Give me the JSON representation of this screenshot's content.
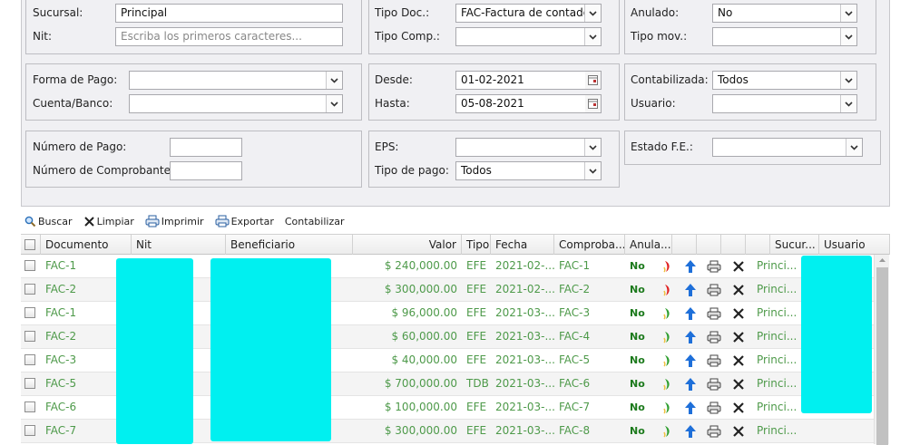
{
  "filters": {
    "sucursal": {
      "label": "Sucursal:",
      "value": "Principal"
    },
    "nit": {
      "label": "Nit:",
      "placeholder": "Escriba los primeros caracteres..."
    },
    "tipo_doc": {
      "label": "Tipo Doc.:",
      "value": "FAC-Factura de contado"
    },
    "tipo_comp": {
      "label": "Tipo Comp.:",
      "value": ""
    },
    "anulado": {
      "label": "Anulado:",
      "value": "No"
    },
    "tipo_mov": {
      "label": "Tipo mov.:",
      "value": ""
    },
    "forma_pago": {
      "label": "Forma de Pago:",
      "value": ""
    },
    "cuenta_banco": {
      "label": "Cuenta/Banco:",
      "value": ""
    },
    "desde": {
      "label": "Desde:",
      "value": "01-02-2021"
    },
    "hasta": {
      "label": "Hasta:",
      "value": "05-08-2021"
    },
    "contabilizada": {
      "label": "Contabilizada:",
      "value": "Todos"
    },
    "usuario": {
      "label": "Usuario:",
      "value": ""
    },
    "numero_pago": {
      "label": "Número de Pago:",
      "value": ""
    },
    "numero_comprobante": {
      "label": "Número de Comprobante:",
      "value": ""
    },
    "eps": {
      "label": "EPS:",
      "value": ""
    },
    "tipo_pago": {
      "label": "Tipo de pago:",
      "value": "Todos"
    },
    "estado_fe": {
      "label": "Estado F.E.:",
      "value": ""
    }
  },
  "toolbar": {
    "buscar": "Buscar",
    "limpiar": "Limpiar",
    "imprimir": "Imprimir",
    "exportar": "Exportar",
    "contabilizar": "Contabilizar"
  },
  "columns": {
    "documento": "Documento",
    "nit": "Nit",
    "beneficiario": "Beneficiario",
    "valor": "Valor",
    "tipo": "Tipo",
    "fecha": "Fecha",
    "comprobante": "Comproba...",
    "anulado": "Anula...",
    "sucursal": "Sucur...",
    "usuario": "Usuario"
  },
  "rows": [
    {
      "documento": "FAC-1",
      "valor": "$ 240,000.00",
      "tipo": "EFE",
      "fecha": "2021-02-...",
      "comprobante": "FAC-1",
      "anulado": "No",
      "sucursal": "Princi...",
      "status": "red"
    },
    {
      "documento": "FAC-2",
      "valor": "$ 300,000.00",
      "tipo": "EFE",
      "fecha": "2021-02-...",
      "comprobante": "FAC-2",
      "anulado": "No",
      "sucursal": "Princi...",
      "status": "red"
    },
    {
      "documento": "FAC-1",
      "valor": "$ 96,000.00",
      "tipo": "EFE",
      "fecha": "2021-03-...",
      "comprobante": "FAC-3",
      "anulado": "No",
      "sucursal": "Princi...",
      "status": "green"
    },
    {
      "documento": "FAC-2",
      "valor": "$ 60,000.00",
      "tipo": "EFE",
      "fecha": "2021-03-...",
      "comprobante": "FAC-4",
      "anulado": "No",
      "sucursal": "Princi...",
      "status": "green"
    },
    {
      "documento": "FAC-3",
      "valor": "$ 40,000.00",
      "tipo": "EFE",
      "fecha": "2021-03-...",
      "comprobante": "FAC-5",
      "anulado": "No",
      "sucursal": "Princi...",
      "status": "green"
    },
    {
      "documento": "FAC-5",
      "valor": "$ 700,000.00",
      "tipo": "TDB",
      "fecha": "2021-03-...",
      "comprobante": "FAC-6",
      "anulado": "No",
      "sucursal": "Princi...",
      "status": "green"
    },
    {
      "documento": "FAC-6",
      "valor": "$ 100,000.00",
      "tipo": "EFE",
      "fecha": "2021-03-...",
      "comprobante": "FAC-7",
      "anulado": "No",
      "sucursal": "Princi...",
      "status": "green"
    },
    {
      "documento": "FAC-7",
      "valor": "$ 300,000.00",
      "tipo": "EFE",
      "fecha": "2021-03-...",
      "comprobante": "FAC-8",
      "anulado": "No",
      "sucursal": "Princi...",
      "status": "green"
    }
  ],
  "icons": {
    "status": "status-leaf-icon",
    "upload": "upload-arrow-icon",
    "print": "printer-icon",
    "delete": "close-icon"
  },
  "colors": {
    "accent_link": "#4e9a4a",
    "no_text": "#1c7a1c",
    "redacted": "#00f0f0",
    "upload_blue": "#1e6fd9"
  }
}
